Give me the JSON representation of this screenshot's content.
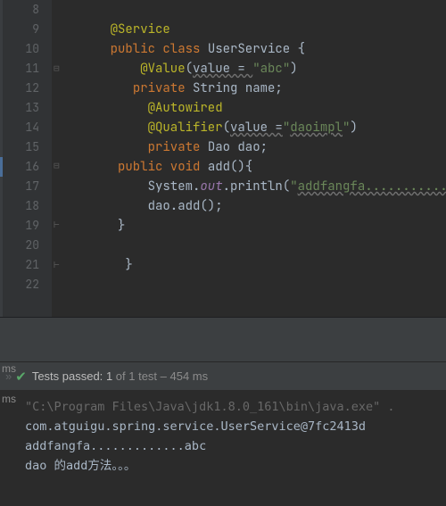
{
  "editor": {
    "first_line_no": 8,
    "lines": [
      {
        "n": 8,
        "segs": []
      },
      {
        "n": 9,
        "segs": [
          [
            "    ",
            ""
          ],
          [
            "@Service",
            "ann"
          ]
        ]
      },
      {
        "n": 10,
        "segs": [
          [
            "    ",
            ""
          ],
          [
            "public class ",
            "kw"
          ],
          [
            "UserService {",
            "norm"
          ]
        ]
      },
      {
        "n": 11,
        "segs": [
          [
            "        ",
            ""
          ],
          [
            "@Value",
            "ann"
          ],
          [
            "(",
            "norm"
          ],
          [
            "value = ",
            "wavy"
          ],
          [
            "\"abc\"",
            "str"
          ],
          [
            ")",
            "norm"
          ]
        ]
      },
      {
        "n": 12,
        "segs": [
          [
            "       ",
            ""
          ],
          [
            "private ",
            "kw"
          ],
          [
            "String name;",
            "norm"
          ]
        ]
      },
      {
        "n": 13,
        "segs": [
          [
            "         ",
            ""
          ],
          [
            "@Autowired",
            "ann"
          ]
        ]
      },
      {
        "n": 14,
        "segs": [
          [
            "         ",
            ""
          ],
          [
            "@Qualifier",
            "ann"
          ],
          [
            "(",
            "norm"
          ],
          [
            "value =",
            "wavy"
          ],
          [
            "\"",
            "str"
          ],
          [
            "daoimpl",
            "str wavy"
          ],
          [
            "\"",
            "str"
          ],
          [
            ")",
            "norm"
          ]
        ]
      },
      {
        "n": 15,
        "segs": [
          [
            "         ",
            ""
          ],
          [
            "private ",
            "kw"
          ],
          [
            "Dao dao;",
            "norm"
          ]
        ]
      },
      {
        "n": 16,
        "segs": [
          [
            "     ",
            ""
          ],
          [
            "public void ",
            "kw"
          ],
          [
            "add(){",
            "norm"
          ]
        ]
      },
      {
        "n": 17,
        "segs": [
          [
            "         System.",
            ""
          ],
          [
            "out",
            "fld"
          ],
          [
            ".println(",
            "norm"
          ],
          [
            "\"",
            "str"
          ],
          [
            "addfangfa...........",
            "str wavy"
          ],
          [
            "",
            "norm"
          ]
        ]
      },
      {
        "n": 18,
        "segs": [
          [
            "         dao.add();",
            "norm"
          ]
        ]
      },
      {
        "n": 19,
        "segs": [
          [
            "     }",
            "norm"
          ]
        ]
      },
      {
        "n": 20,
        "segs": []
      },
      {
        "n": 21,
        "segs": [
          [
            "      }",
            "norm"
          ]
        ]
      },
      {
        "n": 22,
        "segs": []
      }
    ]
  },
  "tests": {
    "label_prefix": "Tests passed:",
    "count": "1",
    "suffix": "of 1 test – 454 ms"
  },
  "console": {
    "side_tab_1": "ms",
    "side_tab_2": "ms",
    "lines": [
      {
        "text": "\"C:\\Program Files\\Java\\jdk1.8.0_161\\bin\\java.exe\" .",
        "cls": "dim"
      },
      {
        "text": "com.atguigu.spring.service.UserService@7fc2413d",
        "cls": ""
      },
      {
        "text": "addfangfa.............abc",
        "cls": ""
      },
      {
        "text": "dao 的add方法。。。",
        "cls": ""
      }
    ]
  }
}
